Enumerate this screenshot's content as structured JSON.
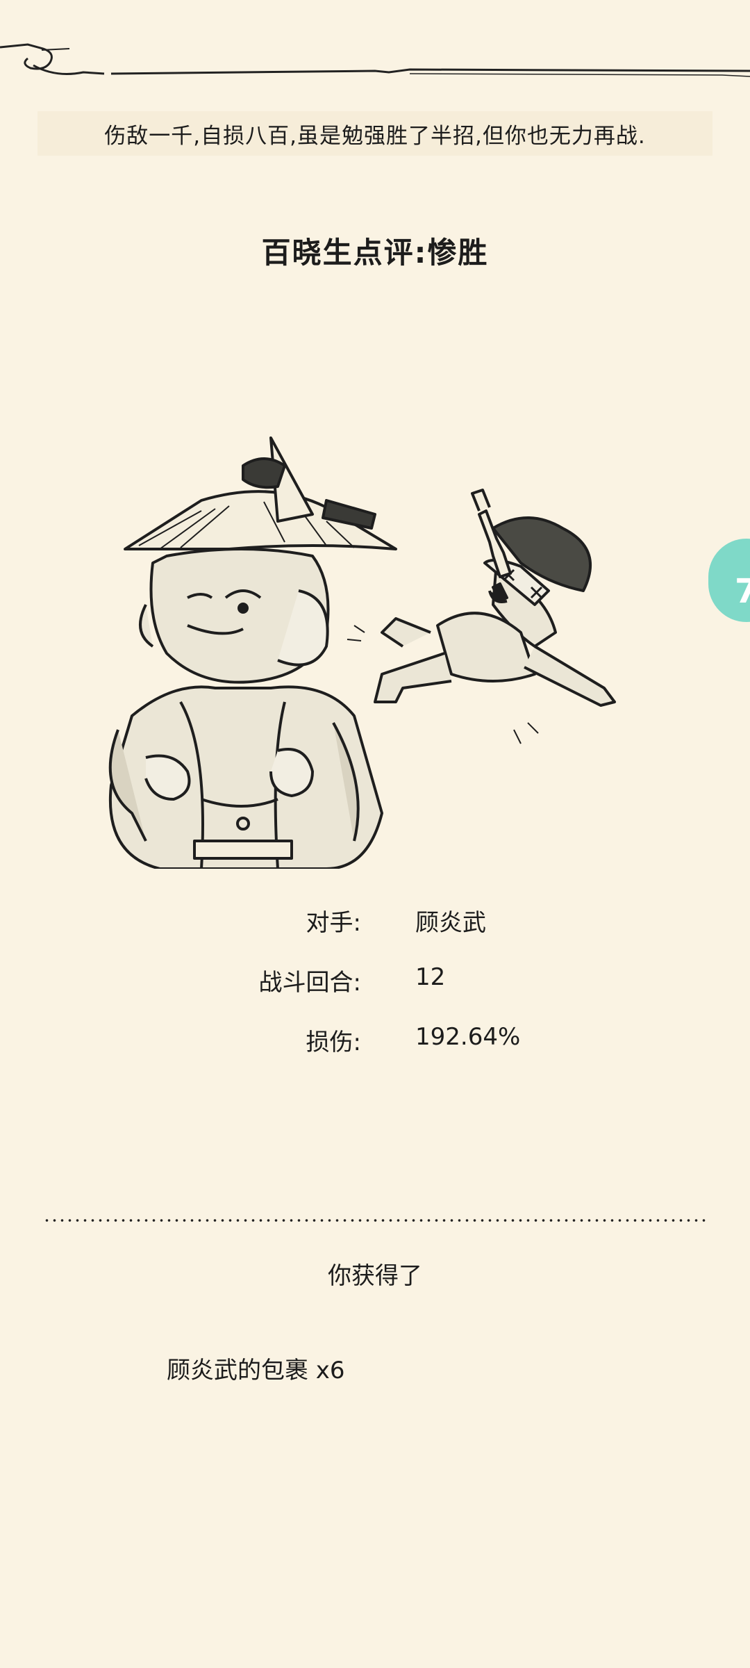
{
  "summary": "伤敌一千,自损八百,虽是勉强胜了半招,但你也无力再战.",
  "title": "百晓生点评:惨胜",
  "stats": [
    {
      "label": "对手:",
      "value": "顾炎武"
    },
    {
      "label": "战斗回合:",
      "value": "12"
    },
    {
      "label": "损伤:",
      "value": "192.64%"
    }
  ],
  "reward": {
    "heading": "你获得了",
    "item": "顾炎武的包裹 x6"
  },
  "colors": {
    "background": "#faf3e3",
    "band": "#f6edd9",
    "floating_tab": "#7fd9c8"
  },
  "icons": {
    "floating_tab": "floating-assistant-icon"
  }
}
